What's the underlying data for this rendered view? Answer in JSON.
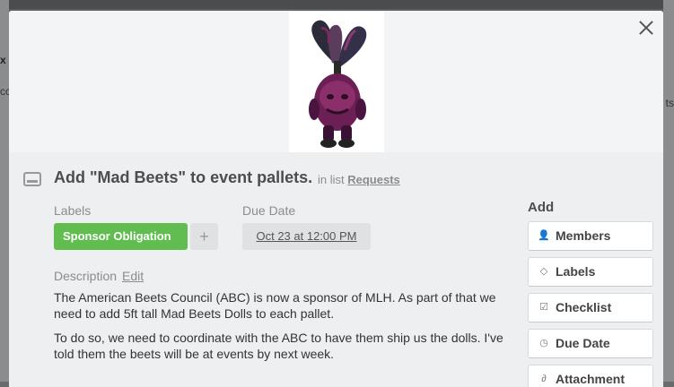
{
  "backdrop": {
    "left_text_1": "x",
    "left_text_2": "cc",
    "right_text_1": "ts"
  },
  "card": {
    "title": "Add \"Mad Beets\" to event pallets.",
    "in_list_prefix": "in list",
    "list_name": "Requests",
    "labels_heading": "Labels",
    "label_chip": "Sponsor Obligation",
    "label_color": "#61bd4f",
    "add_label": "+",
    "due_heading": "Due Date",
    "due_value": "Oct 23 at 12:00 PM",
    "description_heading": "Description",
    "description_edit": "Edit",
    "description_p1": "The American Beets Council (ABC) is now a sponsor of MLH. As part of that we need to add 5ft tall Mad Beets Dolls to each pallet.",
    "description_p2": "To do so, we need to coordinate with the ABC to have them ship us the dolls. I've told them the beets will be at events by next week."
  },
  "sidebar": {
    "heading": "Add",
    "buttons": [
      {
        "label": "Members",
        "icon": "person-icon"
      },
      {
        "label": "Labels",
        "icon": "tag-icon"
      },
      {
        "label": "Checklist",
        "icon": "checkbox-icon"
      },
      {
        "label": "Due Date",
        "icon": "clock-icon"
      },
      {
        "label": "Attachment",
        "icon": "paperclip-icon"
      }
    ]
  }
}
